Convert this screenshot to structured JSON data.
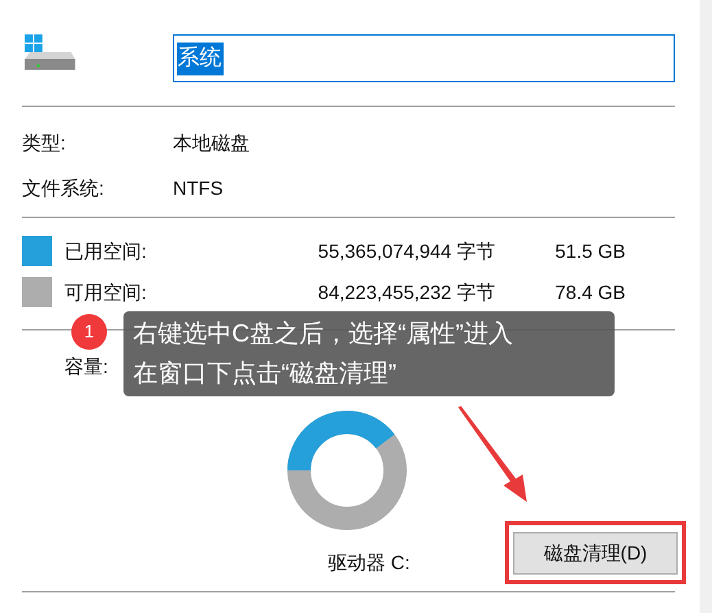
{
  "drive_name": {
    "value": "系统",
    "selected": true
  },
  "info": [
    {
      "label": "类型:",
      "value": "本地磁盘"
    },
    {
      "label": "文件系统:",
      "value": "NTFS"
    }
  ],
  "space": [
    {
      "label": "已用空间:",
      "bytes": "55,365,074,944 字节",
      "size": "51.5 GB",
      "color": "#26a0da"
    },
    {
      "label": "可用空间:",
      "bytes": "84,223,455,232 字节",
      "size": "78.4 GB",
      "color": "#adadad"
    }
  ],
  "capacity": {
    "label": "容量:"
  },
  "usage": {
    "level": 0.396
  },
  "drive_label": "驱动器 C:",
  "cleanup_button": {
    "label": "磁盘清理(D)",
    "highlighted": true
  },
  "annotation": {
    "number": "1",
    "lines": [
      "右键选中C盘之后，选择“属性”进入",
      "在窗口下点击“磁盘清理”"
    ]
  }
}
